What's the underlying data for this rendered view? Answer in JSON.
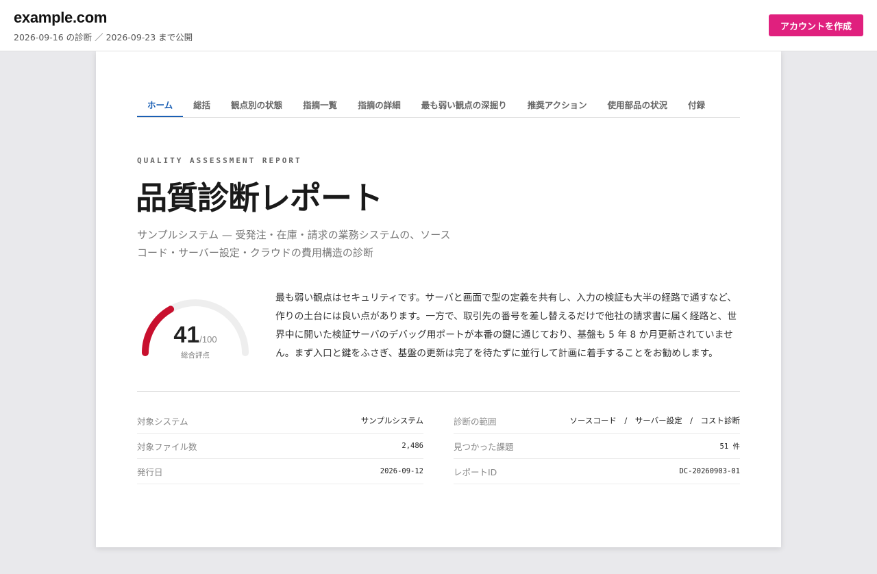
{
  "header": {
    "site": "example.com",
    "subline": "2026-09-16 の診断 ／ 2026-09-23 まで公開",
    "cta_label": "アカウントを作成"
  },
  "tabs": [
    {
      "label": "ホーム",
      "active": true
    },
    {
      "label": "総括"
    },
    {
      "label": "観点別の状態"
    },
    {
      "label": "指摘一覧"
    },
    {
      "label": "指摘の詳細"
    },
    {
      "label": "最も弱い観点の深掘り"
    },
    {
      "label": "推奨アクション"
    },
    {
      "label": "使用部品の状況"
    },
    {
      "label": "付録"
    }
  ],
  "report": {
    "kicker": "QUALITY ASSESSMENT REPORT",
    "title": "品質診断レポート",
    "description": "サンプルシステム — 受発注・在庫・請求の業務システムの、ソースコード・サーバー設定・クラウドの費用構造の診断",
    "summary": "最も弱い観点はセキュリティです。サーバと画面で型の定義を共有し、入力の検証も大半の経路で通すなど、作りの土台には良い点があります。一方で、取引先の番号を差し替えるだけで他社の請求書に届く経路と、世界中に開いた検証サーバのデバッグ用ポートが本番の鍵に通じており、基盤も 5 年 8 か月更新されていません。まず入口と鍵をふさぎ、基盤の更新は完了を待たずに並行して計画に着手することをお勧めします。"
  },
  "score": {
    "value": 41,
    "max_label": "/100",
    "max": 100,
    "label": "総合評点",
    "color": "#c8102e",
    "track_color": "#eeeeee"
  },
  "meta": {
    "left": [
      {
        "key": "対象システム",
        "value": "サンプルシステム"
      },
      {
        "key": "対象ファイル数",
        "value": "2,486"
      },
      {
        "key": "発行日",
        "value": "2026-09-12"
      }
    ],
    "right": [
      {
        "key": "診断の範囲",
        "value": "ソースコード　/　サーバー設定　/　コスト診断"
      },
      {
        "key": "見つかった課題",
        "value": "51 件"
      },
      {
        "key": "レポートID",
        "value": "DC-20260903-01"
      }
    ]
  }
}
